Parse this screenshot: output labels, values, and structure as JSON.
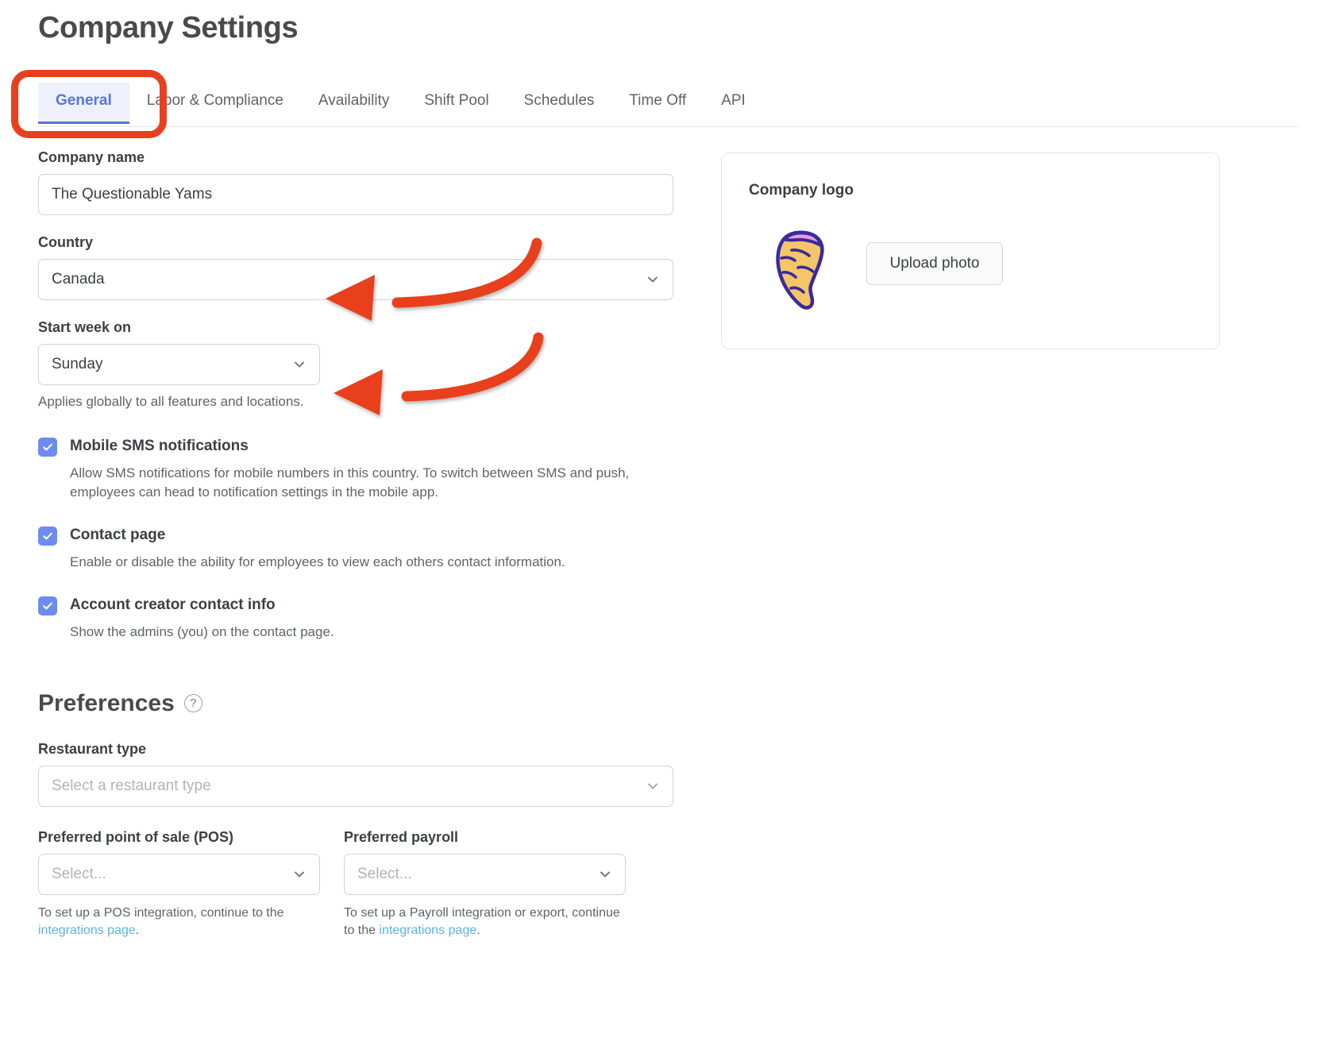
{
  "page": {
    "title": "Company Settings"
  },
  "tabs": [
    {
      "label": "General",
      "active": true
    },
    {
      "label": "Labor & Compliance",
      "active": false
    },
    {
      "label": "Availability",
      "active": false
    },
    {
      "label": "Shift Pool",
      "active": false
    },
    {
      "label": "Schedules",
      "active": false
    },
    {
      "label": "Time Off",
      "active": false
    },
    {
      "label": "API",
      "active": false
    }
  ],
  "form": {
    "company_name_label": "Company name",
    "company_name_value": "The Questionable Yams",
    "country_label": "Country",
    "country_value": "Canada",
    "start_week_label": "Start week on",
    "start_week_value": "Sunday",
    "start_week_helper": "Applies globally to all features and locations."
  },
  "checkboxes": [
    {
      "label": "Mobile SMS notifications",
      "checked": true,
      "description": "Allow SMS notifications for mobile numbers in this country. To switch between SMS and push, employees can head to notification settings in the mobile app."
    },
    {
      "label": "Contact page",
      "checked": true,
      "description": "Enable or disable the ability for employees to view each others contact information."
    },
    {
      "label": "Account creator contact info",
      "checked": true,
      "description": "Show the admins (you) on the contact page."
    }
  ],
  "preferences": {
    "heading": "Preferences",
    "help_icon": "question-mark-icon",
    "restaurant_type_label": "Restaurant type",
    "restaurant_type_placeholder": "Select a restaurant type",
    "pos_label": "Preferred point of sale (POS)",
    "pos_placeholder": "Select...",
    "pos_note_before": "To set up a POS integration, continue to the ",
    "pos_note_link": "integrations page",
    "pos_note_after": ".",
    "payroll_label": "Preferred payroll",
    "payroll_placeholder": "Select...",
    "payroll_note_before": "To set up a Payroll integration or export, continue to the ",
    "payroll_note_link": "integrations page",
    "payroll_note_after": "."
  },
  "logo_card": {
    "title": "Company logo",
    "logo_icon": "yam-sweet-potato-icon",
    "upload_label": "Upload photo"
  },
  "annotations": {
    "highlight_color": "#e8401f",
    "ring_target": "General tab",
    "arrow_1_target": "Country dropdown",
    "arrow_2_target": "Start week on dropdown"
  },
  "colors": {
    "accent_blue": "#5a74d8",
    "checkbox_blue": "#6d8cf0",
    "link_blue": "#5ab4e5",
    "annotation_red": "#e8401f"
  }
}
